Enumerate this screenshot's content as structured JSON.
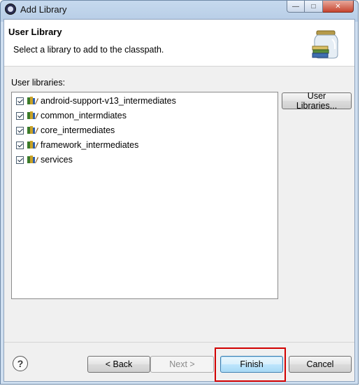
{
  "window": {
    "title": "Add Library",
    "controls": {
      "minimize": "—",
      "maximize": "□",
      "close": "✕"
    }
  },
  "header": {
    "title": "User Library",
    "description": "Select a library to add to the classpath.",
    "icon": "library-jar-icon"
  },
  "libraries": {
    "label": "User libraries:",
    "items": [
      {
        "label": "android-support-v13_intermediates",
        "checked": true
      },
      {
        "label": "common_intermdiates",
        "checked": true
      },
      {
        "label": "core_intermediates",
        "checked": true
      },
      {
        "label": "framework_intermediates",
        "checked": true
      },
      {
        "label": "services",
        "checked": true
      }
    ],
    "user_libraries_button": "User Libraries..."
  },
  "footer": {
    "help_icon": "?",
    "back_label": "< Back",
    "next_label": "Next >",
    "finish_label": "Finish",
    "cancel_label": "Cancel",
    "highlight_color": "#d10000"
  }
}
